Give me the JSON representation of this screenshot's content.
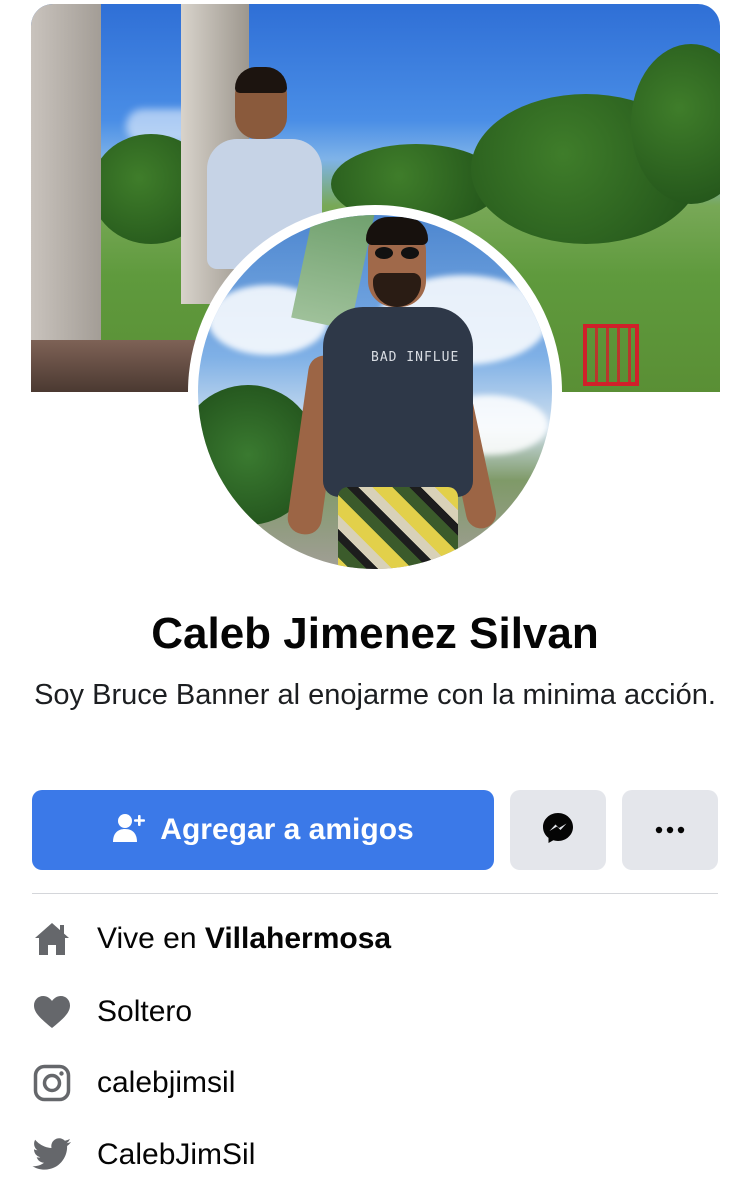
{
  "profile": {
    "name": "Caleb Jimenez Silvan",
    "bio": "Soy Bruce Banner al enojarme con la minima acción.",
    "cover_photo_icon": "cover-photo",
    "avatar_shirt_text": "BAD INFLUE"
  },
  "actions": {
    "add_friend_label": "Agregar a amigos",
    "add_friend_icon": "add-friend-icon",
    "messenger_icon": "messenger-icon",
    "more_icon": "more-icon"
  },
  "details": {
    "lives_prefix": "Vive en",
    "lives_city": "Villahermosa",
    "relationship": "Soltero",
    "instagram": "calebjimsil",
    "twitter": "CalebJimSil"
  },
  "colors": {
    "primary_button": "#3b79e8",
    "secondary_button": "#e4e6eb",
    "icon_gray": "#65676b",
    "text": "#050505"
  }
}
